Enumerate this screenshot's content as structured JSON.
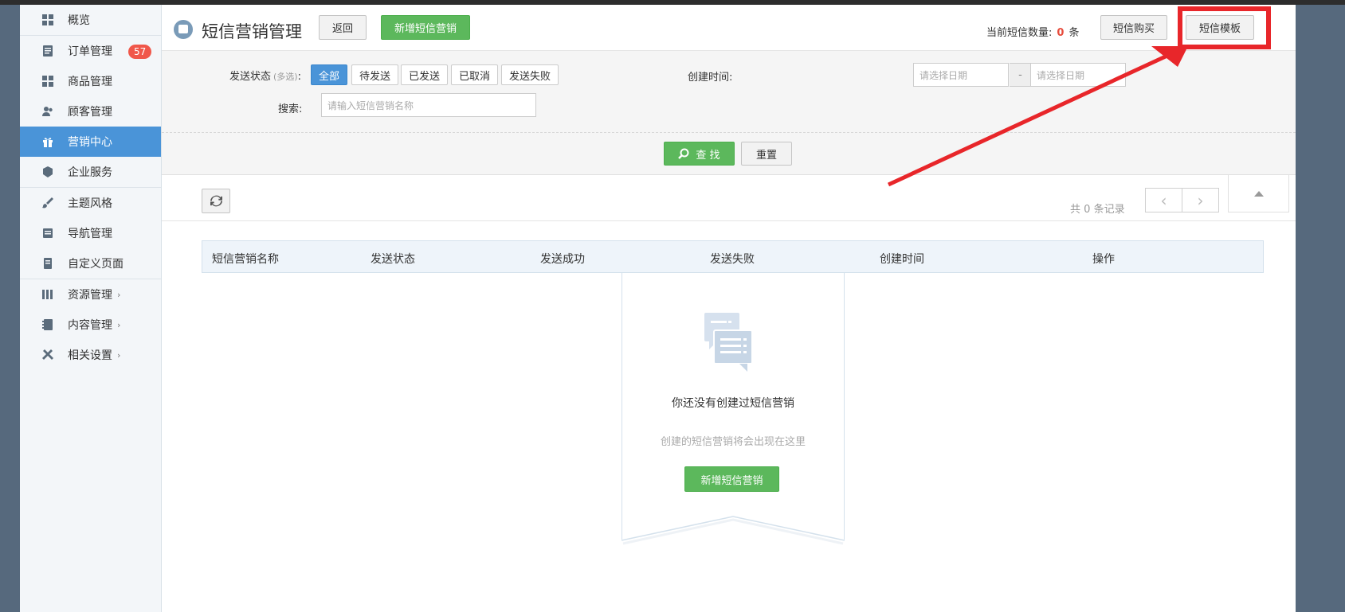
{
  "sidebar": {
    "items": [
      {
        "label": "概览",
        "icon": "dashboard-icon"
      },
      {
        "label": "订单管理",
        "icon": "order-icon",
        "badge": "57"
      },
      {
        "label": "商品管理",
        "icon": "goods-icon"
      },
      {
        "label": "顾客管理",
        "icon": "customer-icon"
      },
      {
        "label": "营销中心",
        "icon": "gift-icon",
        "active": true
      },
      {
        "label": "企业服务",
        "icon": "cube-icon"
      },
      {
        "label": "主题风格",
        "icon": "brush-icon"
      },
      {
        "label": "导航管理",
        "icon": "nav-icon"
      },
      {
        "label": "自定义页面",
        "icon": "page-icon"
      },
      {
        "label": "资源管理",
        "icon": "books-icon"
      },
      {
        "label": "内容管理",
        "icon": "content-icon"
      },
      {
        "label": "相关设置",
        "icon": "tools-icon"
      }
    ]
  },
  "header": {
    "title": "短信营销管理",
    "back_label": "返回",
    "add_label": "新增短信营销",
    "count_prefix": "当前短信数量:",
    "count_value": "0",
    "count_unit": "条",
    "buy_label": "短信购买",
    "template_label": "短信模板"
  },
  "filter": {
    "status_label": "发送状态",
    "status_hint": "(多选)",
    "colon": ":",
    "statuses": [
      "全部",
      "待发送",
      "已发送",
      "已取消",
      "发送失败"
    ],
    "created_label": "创建时间:",
    "date_placeholder": "请选择日期",
    "date_sep": "-",
    "search_label": "搜索:",
    "search_placeholder": "请输入短信营销名称",
    "find_label": "查 找",
    "reset_label": "重置"
  },
  "list": {
    "records_prefix": "共",
    "records_count": "0",
    "records_suffix": "条记录",
    "columns": [
      "短信营销名称",
      "发送状态",
      "发送成功",
      "发送失败",
      "创建时间",
      "操作"
    ]
  },
  "empty": {
    "title": "你还没有创建过短信营销",
    "subtitle": "创建的短信营销将会出现在这里",
    "add_label": "新增短信营销"
  },
  "colors": {
    "accent": "#4a94d8",
    "green": "#5cb85c",
    "annotation": "#e8262a",
    "badge": "#f0574a"
  }
}
